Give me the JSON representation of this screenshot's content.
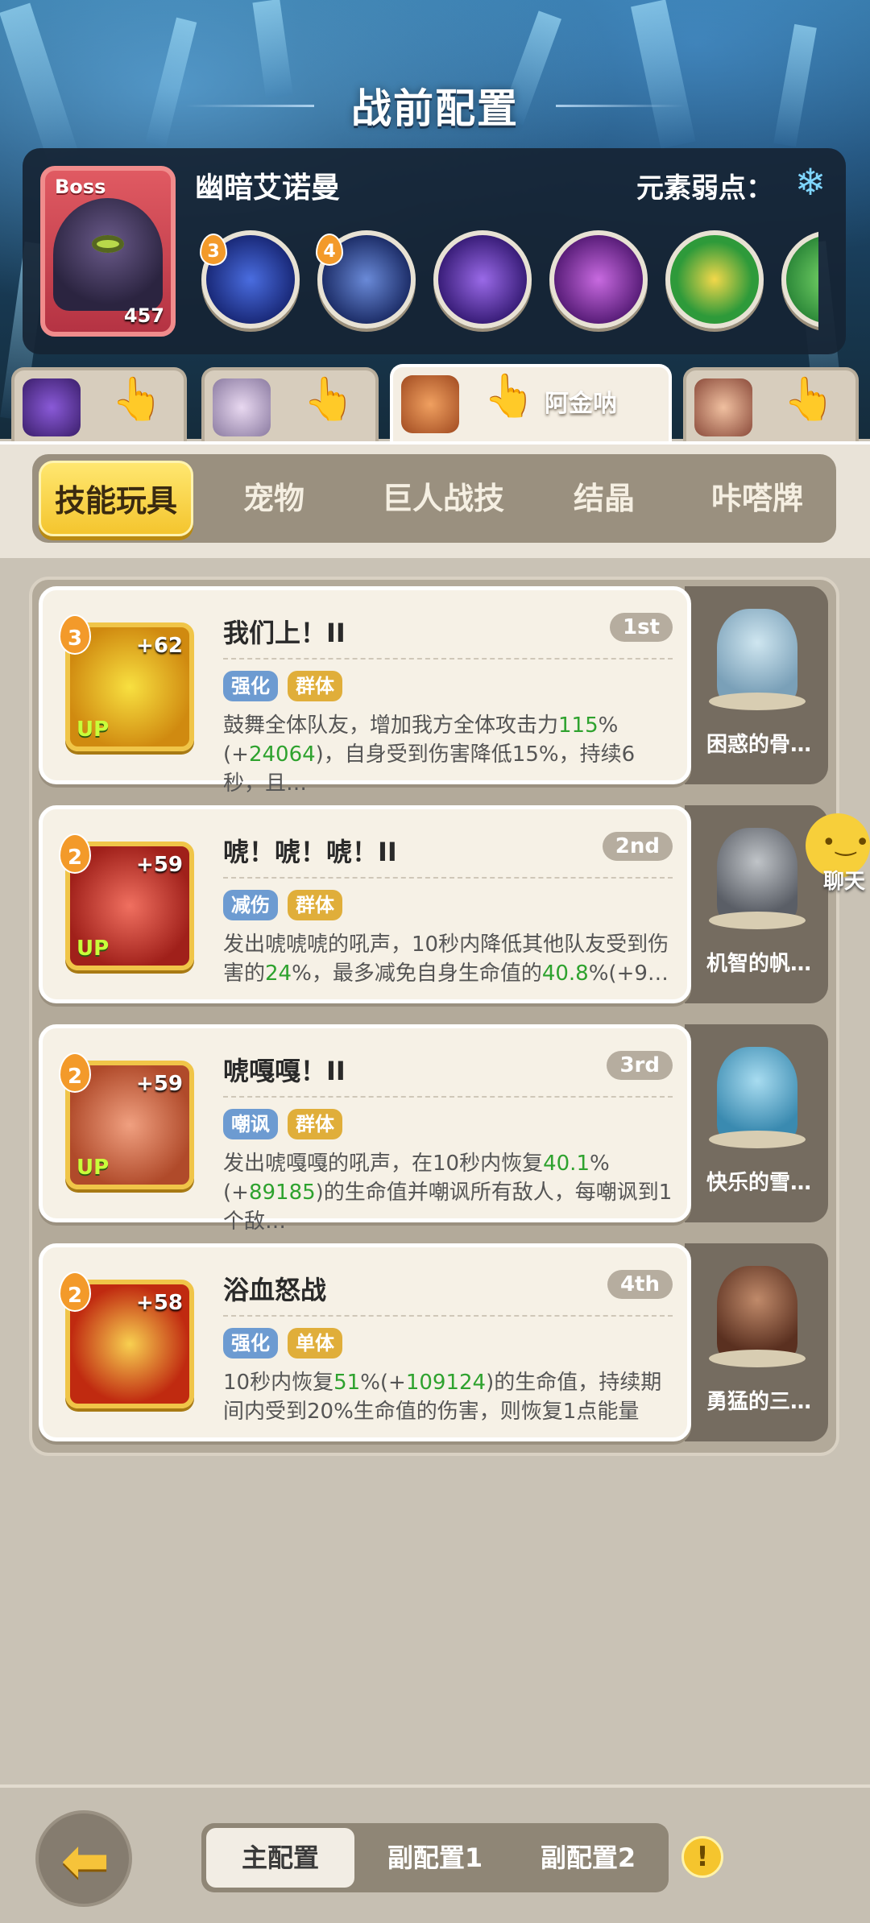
{
  "header": {
    "title": "战前配置"
  },
  "boss": {
    "badge": "Boss",
    "power": "457",
    "name": "幽暗艾诺曼",
    "weakness_label": "元素弱点：",
    "weakness_icon": "snowflake-icon",
    "skills": [
      {
        "level": "3",
        "icon": "dark-burst-icon"
      },
      {
        "level": "4",
        "icon": "shadow-crest-icon"
      },
      {
        "level": "",
        "icon": "dark-drop-icon"
      },
      {
        "level": "",
        "icon": "poison-cloud-icon"
      },
      {
        "level": "",
        "icon": "hourglass-icon"
      },
      {
        "level": "",
        "icon": "partial-skill-icon"
      }
    ]
  },
  "heroes": [
    {
      "name": "",
      "active": false
    },
    {
      "name": "",
      "active": false
    },
    {
      "name": "阿金呐",
      "active": true
    },
    {
      "name": "",
      "active": false
    }
  ],
  "tabs": [
    "技能玩具",
    "宠物",
    "巨人战技",
    "结晶",
    "咔嗒牌"
  ],
  "skills": [
    {
      "level": "3",
      "bonus": "+62",
      "up": "UP",
      "title": "我们上！II",
      "rank": "1st",
      "tags": [
        "强化",
        "群体"
      ],
      "desc_1": "鼓舞全体队友，增加我方全体攻击力",
      "desc_g1": "115",
      "desc_2": "%(+",
      "desc_g2": "24064",
      "desc_3": ")，自身受到伤害降低15%，持续6秒，且…",
      "pet_name": "困惑的骨…"
    },
    {
      "level": "2",
      "bonus": "+59",
      "up": "UP",
      "title": "唬！唬！唬！II",
      "rank": "2nd",
      "tags": [
        "减伤",
        "群体"
      ],
      "desc_1": "发出唬唬唬的吼声，10秒内降低其他队友受到伤害的",
      "desc_g1": "24",
      "desc_2": "%，最多减免自身生命值的",
      "desc_g2": "40.8",
      "desc_3": "%(+9…",
      "pet_name": "机智的帆…"
    },
    {
      "level": "2",
      "bonus": "+59",
      "up": "UP",
      "title": "唬嘎嘎！II",
      "rank": "3rd",
      "tags": [
        "嘲讽",
        "群体"
      ],
      "desc_1": "发出唬嘎嘎的吼声，在10秒内恢复",
      "desc_g1": "40.1",
      "desc_2": "%(+",
      "desc_g2": "89185",
      "desc_3": ")的生命值并嘲讽所有敌人，每嘲讽到1个敌…",
      "pet_name": "快乐的雪…"
    },
    {
      "level": "2",
      "bonus": "+58",
      "up": "",
      "title": "浴血怒战",
      "rank": "4th",
      "tags": [
        "强化",
        "单体"
      ],
      "desc_1": "10秒内恢复",
      "desc_g1": "51",
      "desc_2": "%(+",
      "desc_g2": "109124",
      "desc_3": ")的生命值，持续期间内受到20%生命值的伤害，则恢复1点能量",
      "pet_name": "勇猛的三…"
    }
  ],
  "chat": {
    "label": "聊天"
  },
  "bottom": {
    "configs": [
      "主配置",
      "副配置1",
      "副配置2"
    ],
    "info": "!"
  },
  "colors": {
    "accent": "#f4c52e",
    "highlight_green": "#2ea22e",
    "boss_red": "#d9485a"
  }
}
